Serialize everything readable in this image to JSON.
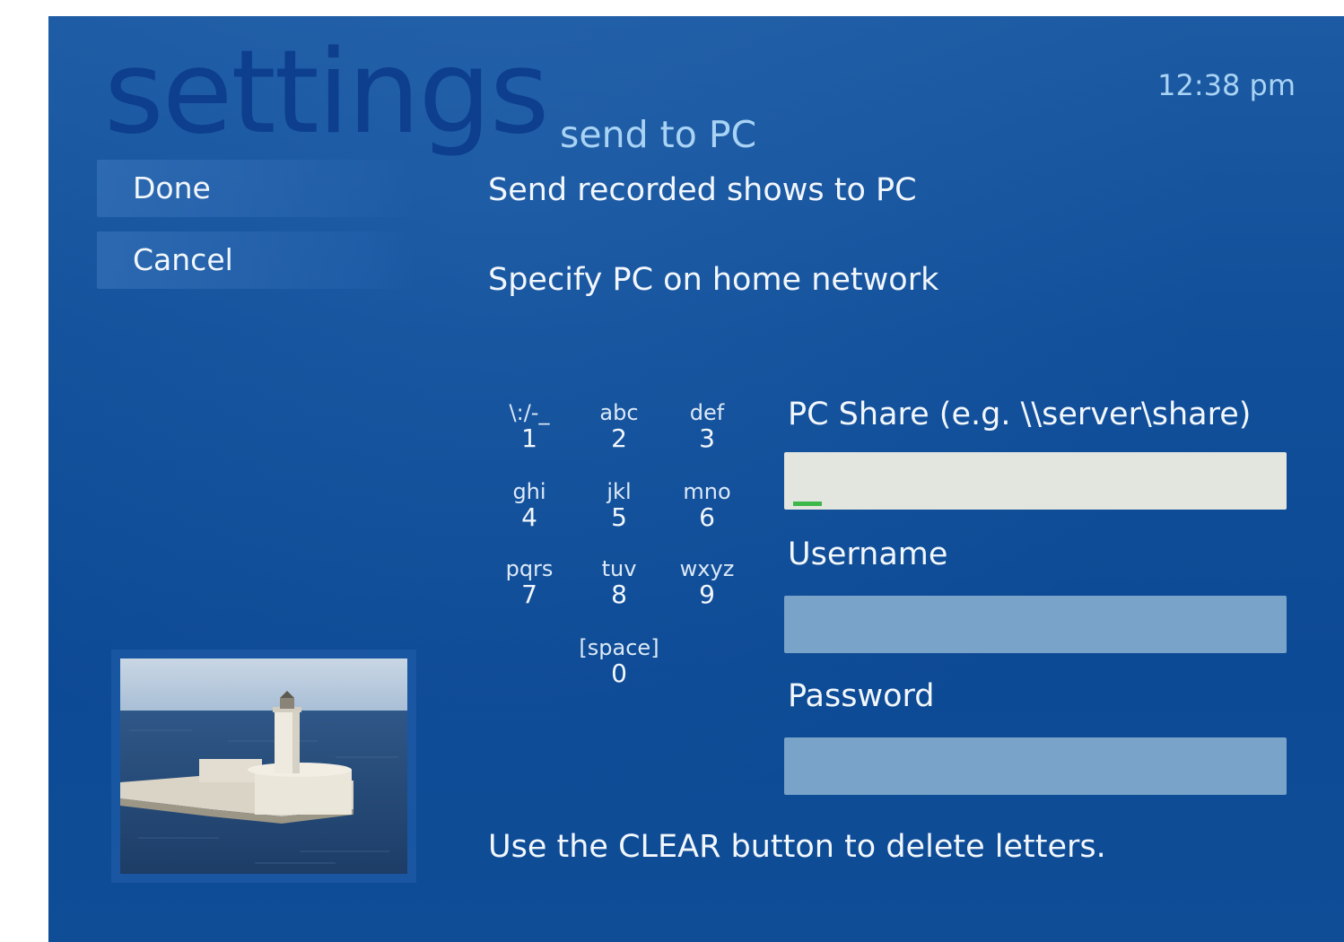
{
  "header": {
    "section_title": "settings",
    "page_title": "send to PC",
    "clock": "12:38 pm"
  },
  "menu": {
    "done_label": "Done",
    "cancel_label": "Cancel"
  },
  "options": {
    "send_recorded": "Send recorded shows to PC",
    "specify_pc": "Specify PC on home network"
  },
  "keypad": {
    "keys": [
      {
        "letters": "\\:/-_",
        "digit": "1"
      },
      {
        "letters": "abc",
        "digit": "2"
      },
      {
        "letters": "def",
        "digit": "3"
      },
      {
        "letters": "ghi",
        "digit": "4"
      },
      {
        "letters": "jkl",
        "digit": "5"
      },
      {
        "letters": "mno",
        "digit": "6"
      },
      {
        "letters": "pqrs",
        "digit": "7"
      },
      {
        "letters": "tuv",
        "digit": "8"
      },
      {
        "letters": "wxyz",
        "digit": "9"
      },
      {
        "letters": "[space]",
        "digit": "0"
      }
    ]
  },
  "form": {
    "share_label": "PC Share (e.g. \\\\server\\share)",
    "share_value": "",
    "username_label": "Username",
    "username_value": "",
    "password_label": "Password",
    "password_value": ""
  },
  "hint": "Use the CLEAR button to delete letters.",
  "colors": {
    "background": "#114f9a",
    "accent_text": "#a9d3f4",
    "active_field": "#e3e5df",
    "inactive_field": "#79a3c8",
    "cursor": "#3cb84a"
  },
  "thumbnail": {
    "icon": "lighthouse-photo"
  }
}
